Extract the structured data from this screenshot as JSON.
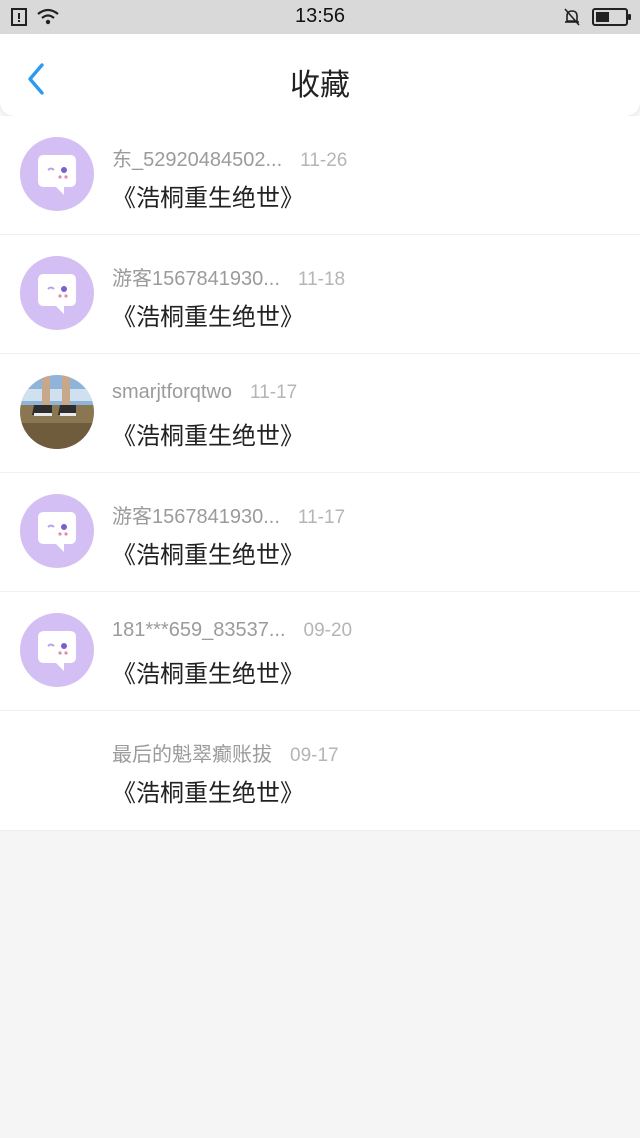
{
  "status": {
    "time": "13:56"
  },
  "header": {
    "title": "收藏"
  },
  "items": [
    {
      "name": "东_52920484502...",
      "date": "11-26",
      "title": "《浩桐重生绝世》",
      "avatar": "bot-avatar"
    },
    {
      "name": "游客1567841930...",
      "date": "11-18",
      "title": "《浩桐重生绝世》",
      "avatar": "bot-avatar"
    },
    {
      "name": "smarjtforqtwo",
      "date": "11-17",
      "title": "《浩桐重生绝世》",
      "avatar": "photo-avatar"
    },
    {
      "name": "游客1567841930...",
      "date": "11-17",
      "title": "《浩桐重生绝世》",
      "avatar": "bot-avatar"
    },
    {
      "name": "181***659_83537...",
      "date": "09-20",
      "title": "《浩桐重生绝世》",
      "avatar": "bot-avatar"
    },
    {
      "name": "最后的魁翠癫账拔",
      "date": "09-17",
      "title": "《浩桐重生绝世》",
      "avatar": "none"
    }
  ],
  "colors": {
    "accent": "#2b9bf2",
    "avatar_bg": "#d3bff3"
  }
}
